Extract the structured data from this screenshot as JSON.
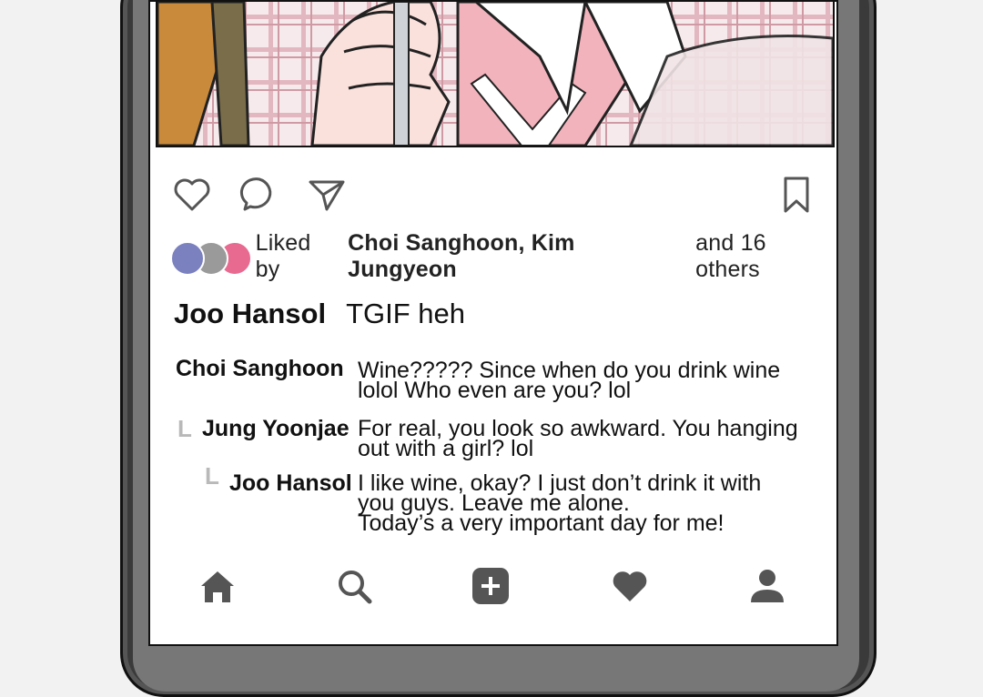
{
  "post": {
    "likes": {
      "prefix": "Liked by",
      "names": "Choi Sanghoon, Kim Jungyeon",
      "suffix": "and 16 others",
      "avatar_colors": [
        "#7b80bf",
        "#9a9a9a",
        "#e86a90"
      ]
    },
    "caption": {
      "user": "Joo Hansol",
      "text": "TGIF heh"
    },
    "comments": [
      {
        "user": "Choi Sanghoon",
        "lines": [
          "Wine????? Since when do you drink wine",
          "lolol Who even are you? lol"
        ]
      },
      {
        "user": "Jung Yoonjae",
        "reply_mark": "L",
        "lines": [
          "For real, you look so awkward. You hanging",
          "out with a girl? lol"
        ]
      },
      {
        "user": "Joo Hansol",
        "reply_mark": "L",
        "lines": [
          "I like wine, okay? I just don’t drink it with",
          "you guys. Leave me alone.",
          "Today’s a very important day for me!"
        ]
      }
    ]
  },
  "actions": [
    "heart-icon",
    "comment-icon",
    "send-icon",
    "bookmark-icon"
  ],
  "nav": [
    "home-icon",
    "search-icon",
    "add-post-icon",
    "activity-heart-icon",
    "profile-icon"
  ],
  "colors": {
    "icon": "#555555",
    "phone": "#3a3a3a",
    "screen": "#ffffff"
  }
}
